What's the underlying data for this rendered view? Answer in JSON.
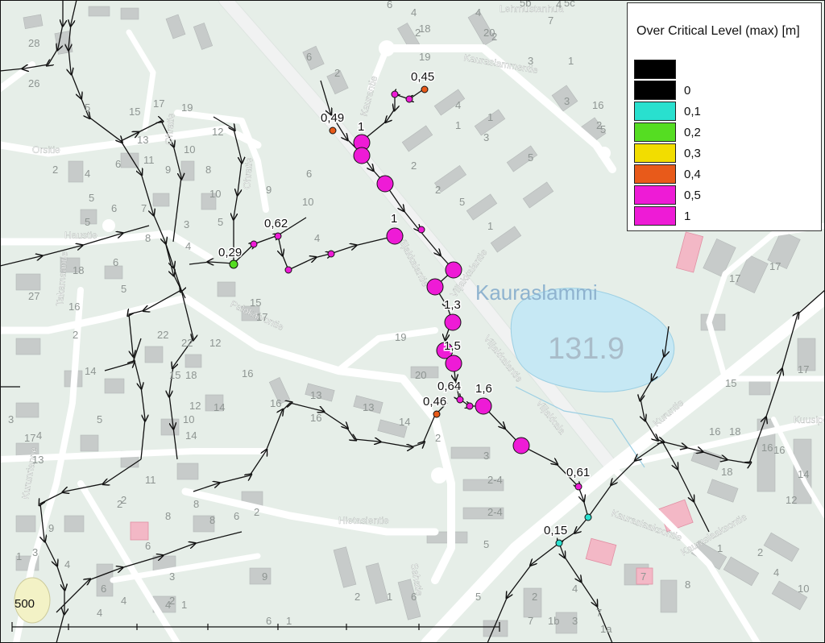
{
  "map": {
    "lake_name": "Kauraslammi",
    "lake_level": "131.9",
    "scale_label": "500",
    "streets": [
      "Kauraslammentie",
      "Viljakkalantie",
      "Viljakkalantie",
      "Viljakkalantie",
      "Viljakkala",
      "Ohratie",
      "Ohratie",
      "Kaurantie",
      "Orsitie",
      "Haustie",
      "Takamaantie",
      "Palokaivontie",
      "Hietasientie",
      "Sahatie",
      "Kuruntie",
      "Kurunrianne",
      "Kuusipolku",
      "Kauraslaaksontie",
      "Kauraslaaksontie",
      "Lehmustanhua"
    ],
    "blocks": [
      "28",
      "26",
      "5",
      "15",
      "17",
      "19",
      "13",
      "11",
      "12",
      "10",
      "2",
      "4",
      "5",
      "6",
      "5",
      "9",
      "8",
      "6",
      "3",
      "7",
      "8",
      "10",
      "9",
      "4",
      "5",
      "18",
      "6",
      "5",
      "27",
      "16",
      "2",
      "14",
      "22",
      "22",
      "18",
      "12",
      "14",
      "16",
      "15",
      "17",
      "19",
      "20",
      "16",
      "13",
      "13",
      "14",
      "16",
      "12",
      "10",
      "14",
      "15",
      "5",
      "3",
      "4",
      "17",
      "13",
      "2",
      "9",
      "11",
      "8",
      "8",
      "8",
      "6",
      "2",
      "2",
      "6",
      "10",
      "4",
      "2",
      "6",
      "4",
      "2",
      "6",
      "4",
      "2",
      "4",
      "1",
      "1",
      "3",
      "2",
      "2",
      "5",
      "5",
      "1",
      "16",
      "2",
      "18",
      "19",
      "20",
      "17",
      "17",
      "15",
      "17",
      "16",
      "18",
      "18",
      "16",
      "16",
      "14",
      "12",
      "1",
      "2",
      "4",
      "10",
      "7",
      "8",
      "9",
      "2",
      "3",
      "4",
      "1",
      "2",
      "4",
      "6",
      "1",
      "2",
      "1",
      "6",
      "5",
      "6",
      "4",
      "2",
      "4",
      "7",
      "1a",
      "1b",
      "3",
      "7",
      "5b",
      "5c",
      "7",
      "1",
      "3",
      "5",
      "3",
      "4",
      "2-4",
      "2-4",
      "3",
      "5",
      "1",
      "3",
      "4",
      "6",
      "8",
      "8",
      "10",
      "6",
      "5"
    ]
  },
  "points": [
    {
      "label": "0,45",
      "color": "#e85a1a"
    },
    {
      "label": "0,49",
      "color": "#e85a1a"
    },
    {
      "label": "1",
      "color": "#ee1bd6"
    },
    {
      "label": "0,62",
      "color": "#ee1bd6"
    },
    {
      "label": "0,29",
      "color": "#55dd22"
    },
    {
      "label": "1",
      "color": "#ee1bd6"
    },
    {
      "label": "1,3",
      "color": "#ee1bd6"
    },
    {
      "label": "1,5",
      "color": "#ee1bd6"
    },
    {
      "label": "0,64",
      "color": "#ee1bd6"
    },
    {
      "label": "1,6",
      "color": "#ee1bd6"
    },
    {
      "label": "0,46",
      "color": "#e85a1a"
    },
    {
      "label": "0,61",
      "color": "#ee1bd6"
    },
    {
      "label": "0,15",
      "color": "#29e0cf"
    }
  ],
  "legend": {
    "title": "Over Critical Level (max) [m]",
    "items": [
      {
        "label": "",
        "color": "#000000"
      },
      {
        "label": "0",
        "color": "#000000"
      },
      {
        "label": "0,1",
        "color": "#29e0cf"
      },
      {
        "label": "0,2",
        "color": "#55dd22"
      },
      {
        "label": "0,3",
        "color": "#f2dd00"
      },
      {
        "label": "0,4",
        "color": "#e85a1a"
      },
      {
        "label": "0,5",
        "color": "#ee1bd6"
      },
      {
        "label": "1",
        "color": "#ee1bd6"
      }
    ]
  }
}
